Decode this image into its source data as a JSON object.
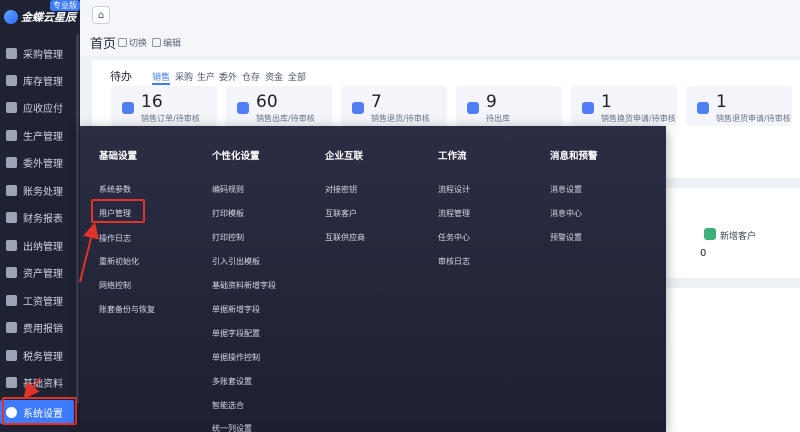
{
  "app": {
    "logo_text": "金蝶云星辰",
    "badge": "专业版"
  },
  "sidebar": {
    "items": [
      {
        "label": "采购管理",
        "icon": "cart-icon"
      },
      {
        "label": "库存管理",
        "icon": "warehouse-icon"
      },
      {
        "label": "应收应付",
        "icon": "money-icon"
      },
      {
        "label": "生产管理",
        "icon": "factory-icon"
      },
      {
        "label": "委外管理",
        "icon": "outsource-icon"
      },
      {
        "label": "账务处理",
        "icon": "ledger-icon"
      },
      {
        "label": "财务报表",
        "icon": "report-icon"
      },
      {
        "label": "出纳管理",
        "icon": "cashier-icon"
      },
      {
        "label": "资产管理",
        "icon": "asset-icon"
      },
      {
        "label": "工资管理",
        "icon": "salary-icon"
      },
      {
        "label": "费用报销",
        "icon": "expense-icon"
      },
      {
        "label": "税务管理",
        "icon": "tax-icon"
      },
      {
        "label": "基础资料",
        "icon": "data-icon"
      },
      {
        "label": "系统设置",
        "icon": "settings-icon"
      }
    ]
  },
  "header": {
    "page_title": "首页",
    "switch_label": "切换",
    "edit_label": "编辑"
  },
  "todo": {
    "title": "待办",
    "filters": [
      "销售",
      "采购",
      "生产",
      "委外",
      "仓存",
      "资金",
      "全部"
    ],
    "cards": [
      {
        "count": "16",
        "label": "销售订单/待审核"
      },
      {
        "count": "60",
        "label": "销售出库/待审核"
      },
      {
        "count": "7",
        "label": "销售退货/待审核"
      },
      {
        "count": "9",
        "label": "待出库"
      },
      {
        "count": "1",
        "label": "销售换货申请/待审核"
      },
      {
        "count": "1",
        "label": "销售退货申请/待审核"
      }
    ]
  },
  "dashboard": {
    "new_customer_label": "新增客户",
    "new_customer_value": "0"
  },
  "mega_menu": {
    "columns": [
      {
        "title": "基础设置",
        "items": [
          "系统参数",
          "用户管理",
          "操作日志",
          "重新初始化",
          "网络控制",
          "账套备份与恢复"
        ]
      },
      {
        "title": "个性化设置",
        "items": [
          "编码规则",
          "打印模板",
          "打印控制",
          "引入引出模板",
          "基础资料新增字段",
          "单据新增字段",
          "单据字段配置",
          "单据操作控制",
          "多账套设置",
          "智能选合",
          "统一列设置"
        ]
      },
      {
        "title": "企业互联",
        "items": [
          "对接密钥",
          "互联客户",
          "互联供应商"
        ]
      },
      {
        "title": "工作流",
        "items": [
          "流程设计",
          "流程管理",
          "任务中心",
          "审核日志"
        ]
      },
      {
        "title": "消息和预警",
        "items": [
          "消息设置",
          "消息中心",
          "预警设置"
        ]
      }
    ]
  },
  "colors": {
    "accent": "#3d7bff",
    "sidebar_bg": "#1f2233",
    "highlight": "#e0342b"
  }
}
